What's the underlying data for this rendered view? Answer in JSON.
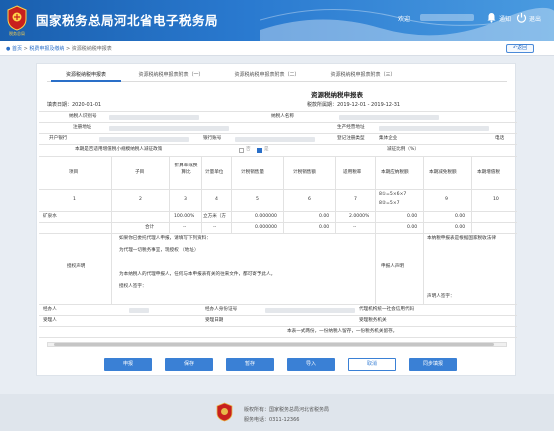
{
  "header": {
    "site_title": "国家税务总局河北省电子税务局",
    "logo_caption": "税务总局",
    "welcome": "欢迎",
    "links": [
      "通知",
      "退出"
    ]
  },
  "breadcrumb": {
    "home": "首页",
    "level1": "税费申报及缴纳",
    "level2": "资源税纳税申报表"
  },
  "back_label": "返回",
  "tabs": [
    "资源税纳税申报表",
    "资源税纳税申报表附表（一）",
    "资源税纳税申报表附表（二）",
    "资源税纳税申报表附表（三）"
  ],
  "form": {
    "title": "资源税纳税申报表",
    "fill_date": "填表日期：2020-01-01",
    "tax_period": "税款所属期：2019-12-01 - 2019-12-31",
    "row1": [
      "纳税人识别号",
      "纳税人名称"
    ],
    "row2": [
      "注册地址",
      "生产经营地址"
    ],
    "row3": [
      "开户银行",
      "银行账号",
      "登记注册类型",
      "集体企业",
      "电话"
    ],
    "small_taxpayer_q": "本期是否适用增值税小规模纳税人减征政策",
    "yes": "是",
    "no": "否",
    "reduction_ratio": "减征比例（%）",
    "headers": [
      "项目",
      "子目",
      "折算率或换算比",
      "计量单位",
      "计税销售量",
      "计税销售额",
      "适用税率",
      "本期应纳税额",
      "本期减免税额",
      "本期增值税"
    ],
    "col_nums": [
      "1",
      "2",
      "3",
      "4",
      "5",
      "6",
      "7",
      "8",
      "9",
      "10"
    ],
    "formula_a": "8①=5×6×7",
    "formula_b": "8②=5×7",
    "data_row": [
      "矿泉水",
      "100.00%",
      "立方米（方",
      "0.000000",
      "0.00",
      "2.0000%",
      "0.00",
      "0.00"
    ],
    "total_row": [
      "合计",
      "--",
      "--",
      "0.000000",
      "0.00",
      "--",
      "0.00",
      "0.00"
    ],
    "authorize_label": "授权声明",
    "authorize_text": [
      "如果你已委托代理人申报，请填写下列资料：",
      "为代理一切税务事宜，现授权          （地址）",
      "为本纳税人的代理申报人，任何与本申报表有关的往来文件，都可寄予此人。",
      "授权人签字："
    ],
    "declare_label": "申报人声明",
    "declare_text": "本纳税申报表是根据国家税收法律",
    "declare_sign": "声明人签字：",
    "agent_row": [
      "经办人",
      "经办人身份证号",
      "代理机构统一社会信用代码"
    ],
    "accept_row": [
      "受理人",
      "受理日期",
      "受理税务机关"
    ],
    "note": "本表一式两份，一份纳税人留存，一份税务机关留存。"
  },
  "buttons": [
    "申报",
    "保存",
    "暂存",
    "导入",
    "取消",
    "同步填报"
  ],
  "footer": {
    "copyright": "版权所有：国家税务总局河北省税务局",
    "hotline": "服务电话：0311-12366"
  }
}
